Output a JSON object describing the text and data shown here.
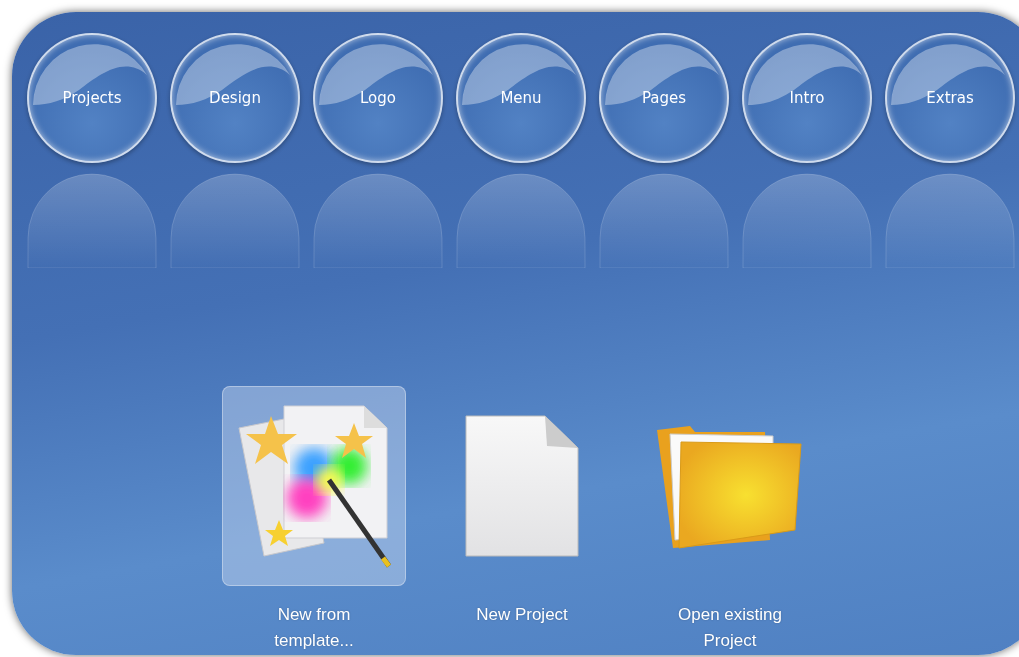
{
  "nav": [
    {
      "label": "Projects"
    },
    {
      "label": "Design"
    },
    {
      "label": "Logo"
    },
    {
      "label": "Menu"
    },
    {
      "label": "Pages"
    },
    {
      "label": "Intro"
    },
    {
      "label": "Extras"
    }
  ],
  "actions": [
    {
      "kind": "template",
      "label": "New from\ntemplate...",
      "selected": true
    },
    {
      "kind": "new",
      "label": "New Project",
      "selected": false
    },
    {
      "kind": "open",
      "label": "Open existing\nProject",
      "selected": false
    }
  ]
}
